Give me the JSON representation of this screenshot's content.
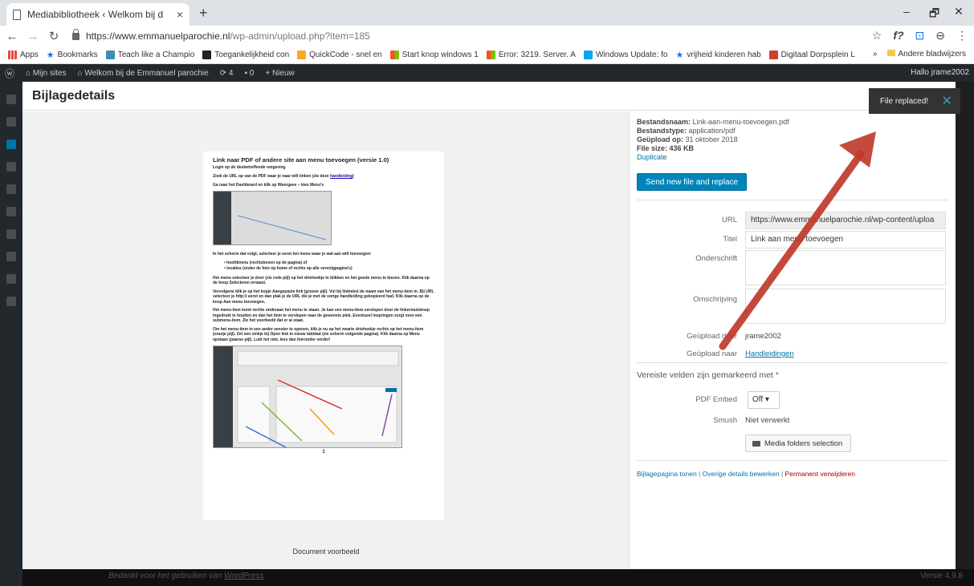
{
  "browser": {
    "tab_title": "Mediabibliotheek ‹ Welkom bij d",
    "tab_close": "×",
    "new_tab": "+",
    "url_host": "https://www.emmanuelparochie.nl",
    "url_path": "/wp-admin/upload.php?item=185",
    "win_min": "–",
    "win_max": "🗗",
    "win_close": "✕",
    "toolbar_right": [
      "☆",
      "f?",
      "⊡",
      "⊖",
      "⋮"
    ]
  },
  "bookmarks": {
    "items": [
      {
        "label": "Apps",
        "color": "#e8453c"
      },
      {
        "label": "Bookmarks",
        "color": "#1a73e8"
      },
      {
        "label": "Teach like a Champio",
        "color": "#3c8dbc"
      },
      {
        "label": "Toegankelijkheid con",
        "color": "#222222"
      },
      {
        "label": "QuickCode - snel en",
        "color": "#f9a825"
      },
      {
        "label": "Start knop windows 1",
        "color": "#f35325"
      },
      {
        "label": "Error: 3219. Server. A",
        "color": "#f35325"
      },
      {
        "label": "Windows Update: fo",
        "color": "#05a6f0"
      },
      {
        "label": "vrijheid kinderen hab",
        "color": "#1a73e8"
      },
      {
        "label": "Digitaal Dorpsplein L",
        "color": "#d33c2c"
      }
    ],
    "more": "»",
    "other": "Andere bladwijzers"
  },
  "wpbar": {
    "sites": "Mijn sites",
    "site_name": "Welkom bij de Emmanuel parochie",
    "updates": "4",
    "comments": "0",
    "new": "+ Nieuw",
    "greeting": "Hallo jrame2002"
  },
  "modal": {
    "title": "Bijlagedetails",
    "doc_caption": "Document voorbeeld"
  },
  "pdf": {
    "heading": "Link naar PDF of andere site aan menu toevoegen (versie 1.0)",
    "sub": "Login op de desbetreffende omgeving",
    "p1_text": "Zoek de URL op van de PDF waar je naar wilt linken (zie deze ",
    "p1_link": "handleiding",
    "p1_end": ")",
    "p2": "Ga naar het Dashboard en klik op Weergave – kies Menu's",
    "p3": "In het scherm dat volgt, selecteer je eerst het menu waar je wat aan wilt toevoegen:",
    "li1": "hoofdmenu (rechtsboven op de pagina) of",
    "li2": "locaties (onder de foto op home of rechts op alle vervolgpagina's)",
    "p4": "Het menu selecteer je door (zie rode pijl) op het driehoekje te klikken en het goede menu te kiezen. Klik daarna op de knop Selecteren ernaast.",
    "p5": "Vervolgens klik je op het kopje Aangepaste link (groene pijl). Vul bij linktekst de naam van het menu-item in. Bij URL selecteer je http:// eerst en dan plak je de URL die je met de vorige handleiding gekopieerd had. Klik daarna op de knop Aan menu toevoegen.",
    "p6": "Het menu-item komt rechts onderaan het menu te staan. Je kan een menu-item verslepen door de linkermuisknop ingedrukt te houden en dan het item te verslepen naar de gewenste plek. Eventueel inspringen zorgt voor een submenu-item. Zie het voorbeeld dat er al staat.",
    "p7": "Om het menu-item in een ander venster te openen, klik je nu op het zwarte driehoekje rechts op het menu-item (oranje pijl). Zet een vinkje bij Open link in nieuw tabblad (zie scherm volgende pagina). Klik daarna op Menu opslaan (paarse pijl). Lukt het niet, lees dan hieronder verder!",
    "page_no": "1"
  },
  "meta": {
    "filename_label": "Bestandsnaam:",
    "filename": "Link-aan-menu-toevoegen.pdf",
    "type_label": "Bestandstype:",
    "type": "application/pdf",
    "uploaded_label": "Geüpload op:",
    "uploaded": "31 oktober 2018",
    "size_label": "File size:",
    "size": "436 KB",
    "duplicate": "Duplicate",
    "replace_btn": "Send new file and replace"
  },
  "fields": {
    "url_label": "URL",
    "url_value": "https://www.emmanuelparochie.nl/wp-content/uploa",
    "title_label": "Titel",
    "title_value": "Link aan menu toevoegen",
    "caption_label": "Onderschrift",
    "desc_label": "Omschrijving",
    "by_label": "Geüpload door",
    "by_value": "jrame2002",
    "to_label": "Geüpload naar",
    "to_value": "Handleidingen"
  },
  "required": {
    "text": "Vereiste velden zijn gemarkeerd met",
    "star": "*"
  },
  "extra": {
    "pdf_embed_label": "PDF Embed",
    "pdf_embed_value": "Off ▾",
    "smush_label": "Smush",
    "smush_value": "Niet verwerkt",
    "folders_btn": "Media folders selection"
  },
  "actions": {
    "view": "Bijlagepagina tonen",
    "edit": "Overige details bewerken",
    "delete": "Permanent verwijderen",
    "sep": "|"
  },
  "toast": {
    "text": "File replaced!",
    "close": "✕"
  },
  "footer": {
    "thanks_prefix": "Bedankt voor het gebruiken van ",
    "thanks_link": "WordPress",
    "version": "Versie 4.9.8"
  },
  "colors": {
    "annotation_arrow": "#c0392b",
    "primary_button": "#0085ba",
    "link": "#0073aa"
  }
}
